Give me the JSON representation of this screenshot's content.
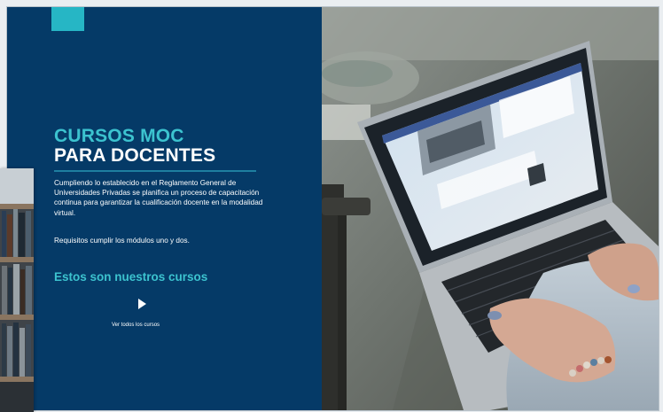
{
  "hero": {
    "title_line1": "CURSOS MOC",
    "title_line2": "PARA DOCENTES",
    "description": "Cumpliendo lo establecido en el Reglamento General de Universidades Privadas se planifica un proceso de capacitación continua para garantizar la cualificación docente en la modalidad virtual.",
    "requirements": "Requisitos cumplir los módulos uno y dos.",
    "courses_heading": "Estos son nuestros cursos",
    "view_all_label": "Ver todos los cursos"
  },
  "images": {
    "main_photo": "laptop-typing-photo",
    "side_photo": "bookshelf-library-photo"
  },
  "colors": {
    "panel_blue": "#053a67",
    "accent_cyan": "#3cc3cf",
    "accent_square": "#26b6c5"
  }
}
